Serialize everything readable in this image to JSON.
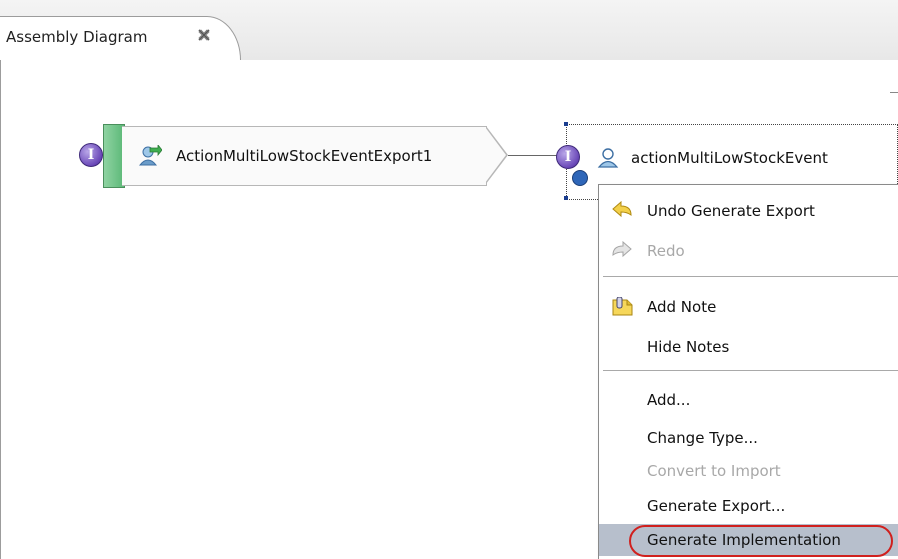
{
  "editor_tab": {
    "title": "Assembly Diagram",
    "close_icon": "close-icon"
  },
  "diagram": {
    "export_node": {
      "label": "ActionMultiLowStockEventExport1",
      "interface_glyph": "I",
      "icon": "export-icon"
    },
    "component_node": {
      "label": "actionMultiLowStockEvent",
      "interface_glyph": "I",
      "icon": "component-icon"
    }
  },
  "context_menu": {
    "items": [
      {
        "label": "Undo Generate Export",
        "icon": "undo-icon",
        "enabled": true
      },
      {
        "label": "Redo",
        "icon": "redo-icon",
        "enabled": false
      },
      {
        "label": "Add Note",
        "icon": "note-icon",
        "enabled": true
      },
      {
        "label": "Hide Notes",
        "enabled": true
      },
      {
        "label": "Add...",
        "enabled": true
      },
      {
        "label": "Change Type...",
        "enabled": true
      },
      {
        "label": "Convert to Import",
        "enabled": false
      },
      {
        "label": "Generate Export...",
        "enabled": true
      },
      {
        "label": "Generate Implementation",
        "enabled": true,
        "selected": true
      }
    ]
  },
  "colors": {
    "interface_purple": "#6a48b8",
    "export_green": "#5bb877",
    "highlight_red": "#d0201e",
    "selection_gray": "#b7bfcc"
  }
}
